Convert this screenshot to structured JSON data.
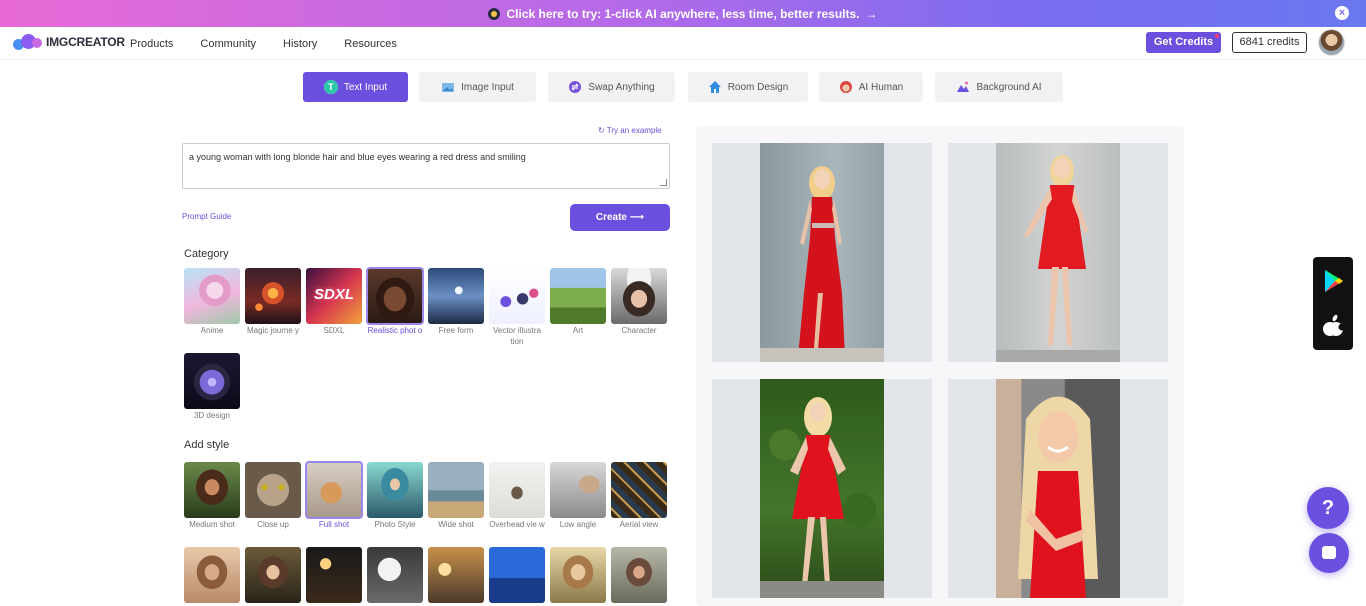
{
  "promo": {
    "text": "Click here to try: 1-click AI anywhere, less time, better results.",
    "arrow": "→",
    "close": "×"
  },
  "nav": {
    "logo_text": "IMGCREATOR",
    "links": [
      "Products",
      "Community",
      "History",
      "Resources"
    ],
    "get_credits": "Get Credits",
    "credits": "6841 credits"
  },
  "tabs": [
    {
      "label": "Text Input",
      "active": true,
      "icon": "text-t-icon"
    },
    {
      "label": "Image Input",
      "active": false,
      "icon": "image-icon"
    },
    {
      "label": "Swap Anything",
      "active": false,
      "icon": "swap-icon"
    },
    {
      "label": "Room Design",
      "active": false,
      "icon": "house-icon"
    },
    {
      "label": "AI Human",
      "active": false,
      "icon": "face-icon"
    },
    {
      "label": "Background AI",
      "active": false,
      "icon": "mountain-icon"
    }
  ],
  "editor": {
    "try_example": "Try an example",
    "prompt": "a young woman with long blonde hair and blue eyes wearing a red dress and smiling",
    "prompt_guide": "Prompt Guide",
    "create": "Create",
    "create_arrow": "⟶"
  },
  "category": {
    "title": "Category",
    "items": [
      {
        "label": "Anime"
      },
      {
        "label": "Magic journe y"
      },
      {
        "label": "SDXL",
        "overlay": "SDXL"
      },
      {
        "label": "Realistic phot o",
        "selected": true
      },
      {
        "label": "Free form"
      },
      {
        "label": "Vector illustra tion"
      },
      {
        "label": "Art"
      },
      {
        "label": "Character"
      },
      {
        "label": "3D design"
      }
    ]
  },
  "style": {
    "title": "Add style",
    "items": [
      {
        "label": "Medium shot"
      },
      {
        "label": "Close up"
      },
      {
        "label": "Full shot",
        "selected": true
      },
      {
        "label": "Photo Style"
      },
      {
        "label": "Wide shot"
      },
      {
        "label": "Overhead vie w"
      },
      {
        "label": "Low angle"
      },
      {
        "label": "Aerial view"
      }
    ]
  },
  "help": "?",
  "colors": {
    "accent": "#6b4fdf",
    "result_dress": "#e0121e"
  }
}
